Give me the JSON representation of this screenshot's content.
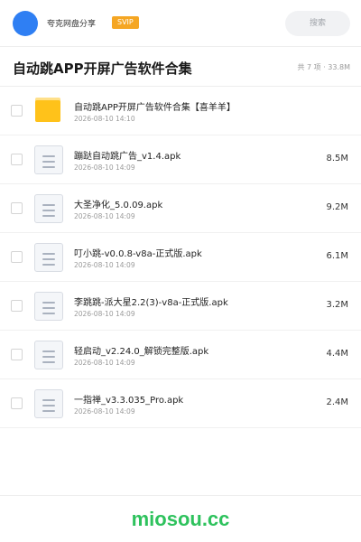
{
  "header": {
    "username": "夸克网盘分享",
    "vip_badge": "SVIP",
    "search_placeholder": "搜索",
    "avatar_color": "#2f7ff3"
  },
  "title_bar": {
    "title": "自动跳APP开屏广告软件合集",
    "summary": "共 7 项 · 33.8M"
  },
  "files": [
    {
      "type": "folder",
      "icon": "folder-icon",
      "name": "自动跳APP开屏广告软件合集【喜羊羊】",
      "date": "2026-08-10 14:10",
      "size": ""
    },
    {
      "type": "file",
      "icon": "document-icon",
      "name": "蹦跶自动跳广告_v1.4.apk",
      "date": "2026-08-10 14:09",
      "size": "8.5M"
    },
    {
      "type": "file",
      "icon": "document-icon",
      "name": "大圣净化_5.0.09.apk",
      "date": "2026-08-10 14:09",
      "size": "9.2M"
    },
    {
      "type": "file",
      "icon": "document-icon",
      "name": "叮小跳-v0.0.8-v8a-正式版.apk",
      "date": "2026-08-10 14:09",
      "size": "6.1M"
    },
    {
      "type": "file",
      "icon": "document-icon",
      "name": "李跳跳-派大星2.2(3)-v8a-正式版.apk",
      "date": "2026-08-10 14:09",
      "size": "3.2M"
    },
    {
      "type": "file",
      "icon": "document-icon",
      "name": "轻启动_v2.24.0_解锁完整版.apk",
      "date": "2026-08-10 14:09",
      "size": "4.4M"
    },
    {
      "type": "file",
      "icon": "document-icon",
      "name": "一指禅_v3.3.035_Pro.apk",
      "date": "2026-08-10 14:09",
      "size": "2.4M"
    }
  ],
  "watermark": "miosou.cc",
  "colors": {
    "accent": "#2f7ff3",
    "vip": "#f5a623",
    "folder": "#ffc21a",
    "watermark": "#2ec25d"
  }
}
